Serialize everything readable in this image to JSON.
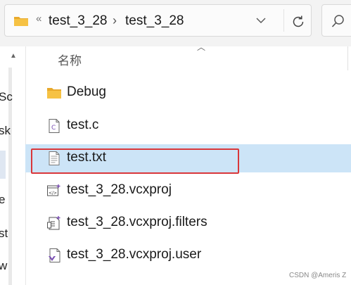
{
  "address_bar": {
    "overflow_chevron": "«",
    "breadcrumbs": [
      "test_3_28",
      "test_3_28"
    ],
    "separator": "›"
  },
  "nav_fragments": [
    "Sc",
    "sk",
    "e",
    "st",
    "w"
  ],
  "file_list": {
    "column_name": "名称",
    "items": [
      {
        "name": "Debug",
        "icon": "folder-icon"
      },
      {
        "name": "test.c",
        "icon": "c-source-file-icon"
      },
      {
        "name": "test.txt",
        "icon": "text-file-icon",
        "selected": true
      },
      {
        "name": "test_3_28.vcxproj",
        "icon": "vcxproj-file-icon"
      },
      {
        "name": "test_3_28.vcxproj.filters",
        "icon": "vcxproj-filters-file-icon"
      },
      {
        "name": "test_3_28.vcxproj.user",
        "icon": "vcxproj-user-file-icon"
      }
    ]
  },
  "colors": {
    "selection": "#cce4f7",
    "highlight_border": "#d9373a",
    "folder": "#f6c244"
  },
  "watermark": "CSDN @Ameris Z"
}
